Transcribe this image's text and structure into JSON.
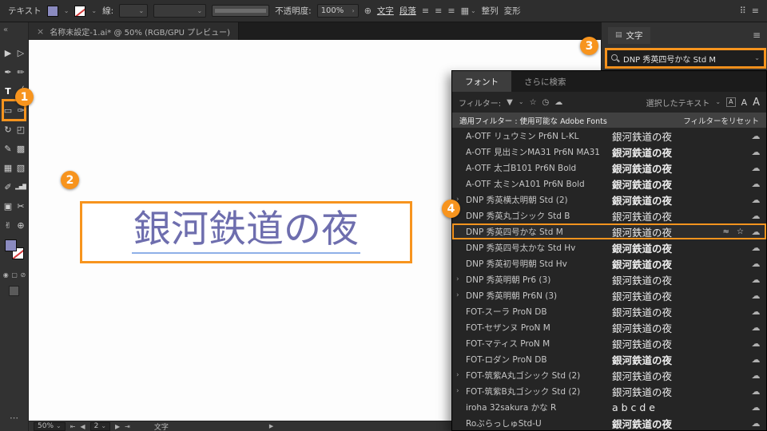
{
  "colors": {
    "accent": "#F7941E",
    "art_text": "#6E6EAE",
    "fill_swatch": "#8B8BC0"
  },
  "topbar": {
    "context_label": "テキスト",
    "stroke_label": "線:",
    "opacity_label": "不透明度:",
    "opacity_value": "100%",
    "character_link": "文字",
    "paragraph_link": "段落",
    "align_label": "整列",
    "transform_label": "変形"
  },
  "tabbar": {
    "close": "×",
    "title": "名称未設定-1.ai* @ 50% (RGB/GPU プレビュー)"
  },
  "toolbar": {
    "collapse": "«",
    "more": "⋯",
    "tools": [
      {
        "id": "selection-tool",
        "glyph": "▶"
      },
      {
        "id": "direct-selection-tool",
        "glyph": "▷"
      },
      {
        "id": "pen-tool",
        "glyph": "✒"
      },
      {
        "id": "curvature-tool",
        "glyph": "✏"
      },
      {
        "id": "type-tool",
        "glyph": "T",
        "active": true
      },
      {
        "id": "line-segment-tool",
        "glyph": "╱"
      },
      {
        "id": "rectangle-tool",
        "glyph": "▭"
      },
      {
        "id": "paintbrush-tool",
        "glyph": "✑"
      },
      {
        "id": "rotate-tool",
        "glyph": "↻"
      },
      {
        "id": "scale-tool",
        "glyph": "◰"
      },
      {
        "id": "pencil-tool",
        "glyph": "✎"
      },
      {
        "id": "blob-brush-tool",
        "glyph": "▩"
      },
      {
        "id": "mesh-tool",
        "glyph": "▦"
      },
      {
        "id": "gradient-tool",
        "glyph": "▧"
      },
      {
        "id": "eyedropper-tool",
        "glyph": "✐"
      },
      {
        "id": "graph-tool",
        "glyph": "▂▅█"
      },
      {
        "id": "artboard-tool",
        "glyph": "▣"
      },
      {
        "id": "slice-tool",
        "glyph": "✂"
      },
      {
        "id": "hand-tool",
        "glyph": "✌"
      },
      {
        "id": "zoom-tool",
        "glyph": "⊕"
      }
    ]
  },
  "canvas": {
    "text": "銀河鉄道の夜"
  },
  "character_panel": {
    "tab": "文字",
    "menu_icon": "≡",
    "font_query": "DNP 秀英四号かな Std M"
  },
  "font_panel": {
    "tab_fonts": "フォント",
    "tab_find_more": "さらに検索",
    "filter_label": "フィルター:",
    "selected_text_label": "選択したテキスト",
    "applied_filter": "適用フィルター : 使用可能な Adobe Fonts",
    "reset_filter": "フィルターをリセット",
    "selected_row_icons": "≈ ☆",
    "expand_glyph": "›",
    "cloud_glyph": "☁",
    "rows": [
      {
        "name": "A-OTF リュウミン Pr6N L-KL",
        "sample": "銀河鉄道の夜",
        "style": "serif"
      },
      {
        "name": "A-OTF 見出ミンMA31 Pr6N MA31",
        "sample": "銀河鉄道の夜",
        "style": "serif bold"
      },
      {
        "name": "A-OTF 太ゴB101 Pr6N Bold",
        "sample": "銀河鉄道の夜",
        "style": "sans bold"
      },
      {
        "name": "A-OTF 太ミンA101 Pr6N Bold",
        "sample": "銀河鉄道の夜",
        "style": "serif bold"
      },
      {
        "name": "DNP 秀英横太明朝 Std (2)",
        "sample": "銀河鉄道の夜",
        "style": "serif bold",
        "expand": true
      },
      {
        "name": "DNP 秀英丸ゴシック Std B",
        "sample": "銀河鉄道の夜",
        "style": "sans"
      },
      {
        "name": "DNP 秀英四号かな Std M",
        "sample": "銀河鉄道の夜",
        "style": "serif",
        "selected": true
      },
      {
        "name": "DNP 秀英四号太かな Std Hv",
        "sample": "銀河鉄道の夜",
        "style": "serif bold"
      },
      {
        "name": "DNP 秀英初号明朝 Std Hv",
        "sample": "銀河鉄道の夜",
        "style": "serif bold"
      },
      {
        "name": "DNP 秀英明朝 Pr6 (3)",
        "sample": "銀河鉄道の夜",
        "style": "serif",
        "expand": true
      },
      {
        "name": "DNP 秀英明朝 Pr6N (3)",
        "sample": "銀河鉄道の夜",
        "style": "serif",
        "expand": true
      },
      {
        "name": "FOT-スーラ ProN DB",
        "sample": "銀河鉄道の夜",
        "style": "sans"
      },
      {
        "name": "FOT-セザンヌ ProN M",
        "sample": "銀河鉄道の夜",
        "style": "serif"
      },
      {
        "name": "FOT-マティス ProN M",
        "sample": "銀河鉄道の夜",
        "style": "serif"
      },
      {
        "name": "FOT-ロダン ProN DB",
        "sample": "銀河鉄道の夜",
        "style": "sans bold"
      },
      {
        "name": "FOT-筑紫A丸ゴシック Std (2)",
        "sample": "銀河鉄道の夜",
        "style": "sans",
        "expand": true
      },
      {
        "name": "FOT-筑紫B丸ゴシック Std (2)",
        "sample": "銀河鉄道の夜",
        "style": "sans",
        "expand": true
      },
      {
        "name": "iroha 32sakura かな R",
        "sample": "a b c d e",
        "style": "sans"
      },
      {
        "name": "RoぶらっしゅStd-U",
        "sample": "銀河鉄道の夜",
        "style": "serif bold"
      }
    ]
  },
  "statusbar": {
    "zoom": "50%",
    "artboard": "2",
    "status": "文字"
  },
  "callouts": {
    "c1": "1",
    "c2": "2",
    "c3": "3",
    "c4": "4"
  }
}
